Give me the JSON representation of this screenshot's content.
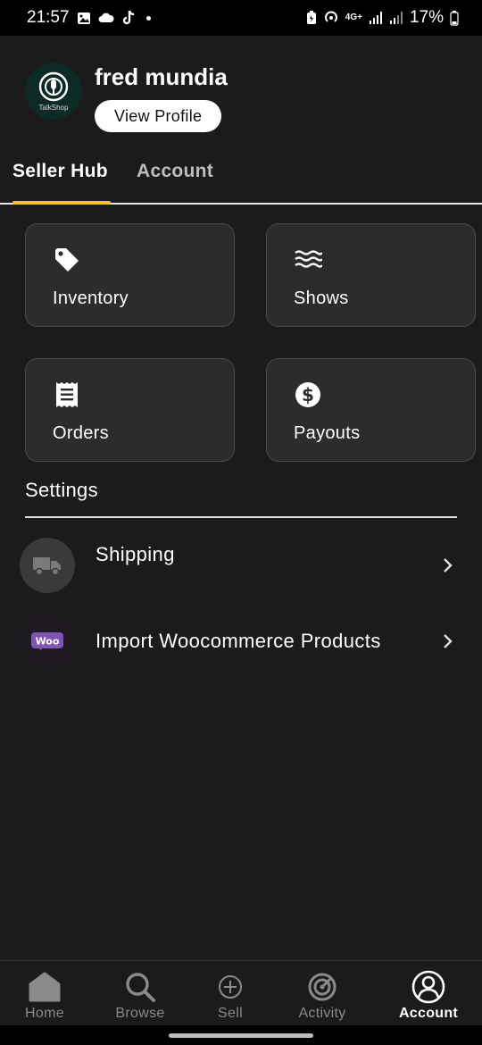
{
  "status_bar": {
    "time": "21:57",
    "battery": "17%",
    "network": "4G+"
  },
  "profile": {
    "name": "fred mundia",
    "view_profile_label": "View Profile",
    "avatar_brand": "TalkShop"
  },
  "tabs": [
    {
      "label": "Seller Hub",
      "active": true
    },
    {
      "label": "Account",
      "active": false
    }
  ],
  "tiles": [
    {
      "label": "Inventory",
      "icon": "tag-icon"
    },
    {
      "label": "Shows",
      "icon": "waves-icon"
    },
    {
      "label": "Orders",
      "icon": "receipt-icon"
    },
    {
      "label": "Payouts",
      "icon": "dollar-icon"
    }
  ],
  "settings": {
    "title": "Settings",
    "items": [
      {
        "label": "Shipping",
        "icon": "truck-icon"
      },
      {
        "label": "Import Woocommerce Products",
        "icon": "woo-icon",
        "badge": "Woo"
      }
    ]
  },
  "bottom_nav": [
    {
      "label": "Home",
      "icon": "home-icon",
      "active": false
    },
    {
      "label": "Browse",
      "icon": "search-icon",
      "active": false
    },
    {
      "label": "Sell",
      "icon": "plus-circle-icon",
      "active": false
    },
    {
      "label": "Activity",
      "icon": "activity-icon",
      "active": false
    },
    {
      "label": "Account",
      "icon": "user-icon",
      "active": true
    }
  ],
  "colors": {
    "background": "#1b1b1b",
    "tile": "#2c2c2c",
    "accent": "#f2c61f",
    "woo_purple": "#7f54b3"
  }
}
